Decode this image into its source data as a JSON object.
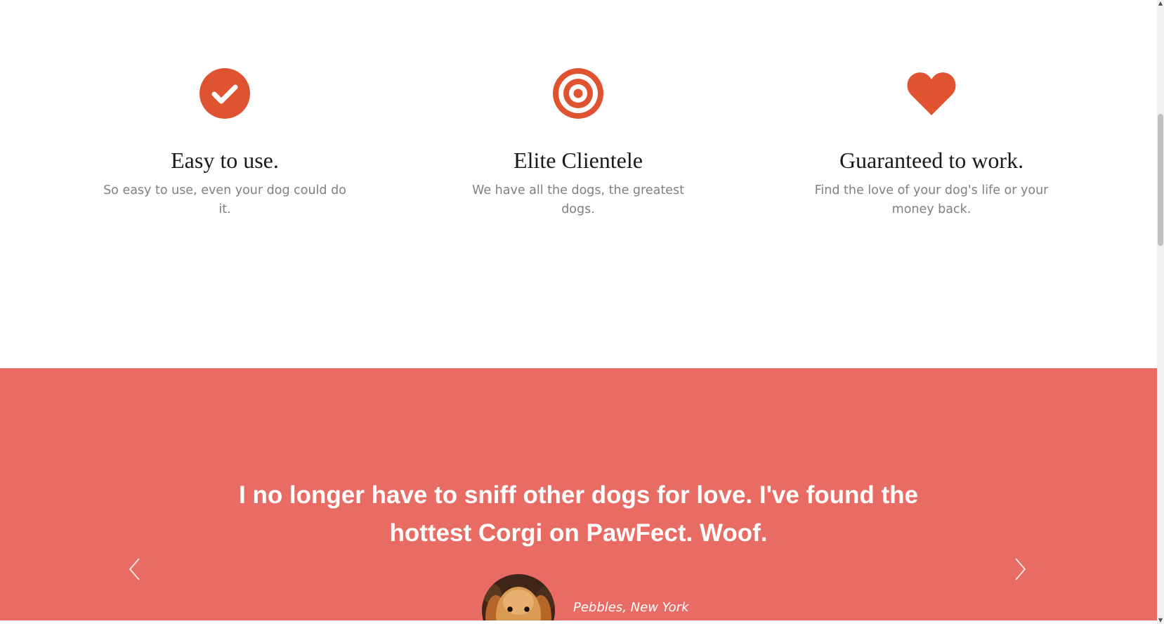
{
  "colors": {
    "accent": "#e05330",
    "testimonial_bg": "#e86c64",
    "heading": "#1a1a1a",
    "body_text": "#808080",
    "white": "#ffffff"
  },
  "features": [
    {
      "icon": "check-circle-icon",
      "title": "Easy to use.",
      "description": "So easy to use, even your dog could do it."
    },
    {
      "icon": "bullseye-icon",
      "title": "Elite Clientele",
      "description": "We have all the dogs, the greatest dogs."
    },
    {
      "icon": "heart-icon",
      "title": "Guaranteed to work.",
      "description": "Find the love of your dog's life or your money back."
    }
  ],
  "testimonial": {
    "quote": "I no longer have to sniff other dogs for love. I've found the hottest Corgi on PawFect. Woof.",
    "author": "Pebbles, New York",
    "avatar_icon": "dog-avatar",
    "prev_icon": "chevron-left-icon",
    "next_icon": "chevron-right-icon"
  }
}
